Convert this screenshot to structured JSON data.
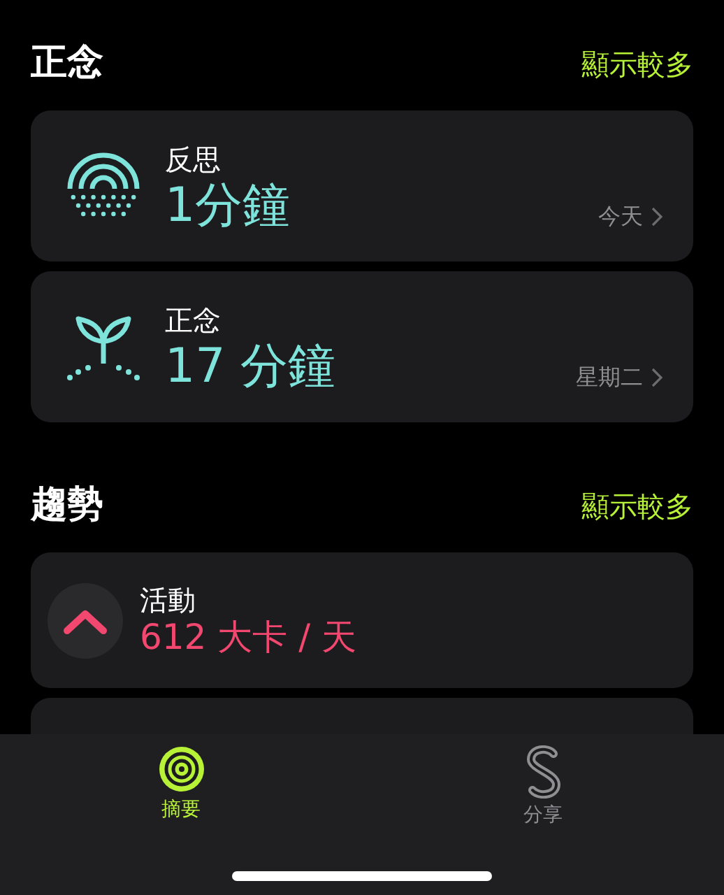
{
  "sections": [
    {
      "title": "正念",
      "more": "顯示較多",
      "cards": [
        {
          "kind": "reflect",
          "title": "反思",
          "value": "1分鐘",
          "date": "今天"
        },
        {
          "kind": "mindful",
          "title": "正念",
          "value": "17 分鐘",
          "date": "星期二"
        }
      ]
    },
    {
      "title": "趨勢",
      "more": "顯示較多",
      "cards": [
        {
          "kind": "trend-up",
          "color": "#f2476f",
          "title": "活動",
          "value": "612 大卡 / 天"
        },
        {
          "kind": "stub"
        }
      ]
    }
  ],
  "tabs": [
    {
      "kind": "rings",
      "label": "摘要",
      "selected": true
    },
    {
      "kind": "share",
      "label": "分享",
      "selected": false
    }
  ]
}
